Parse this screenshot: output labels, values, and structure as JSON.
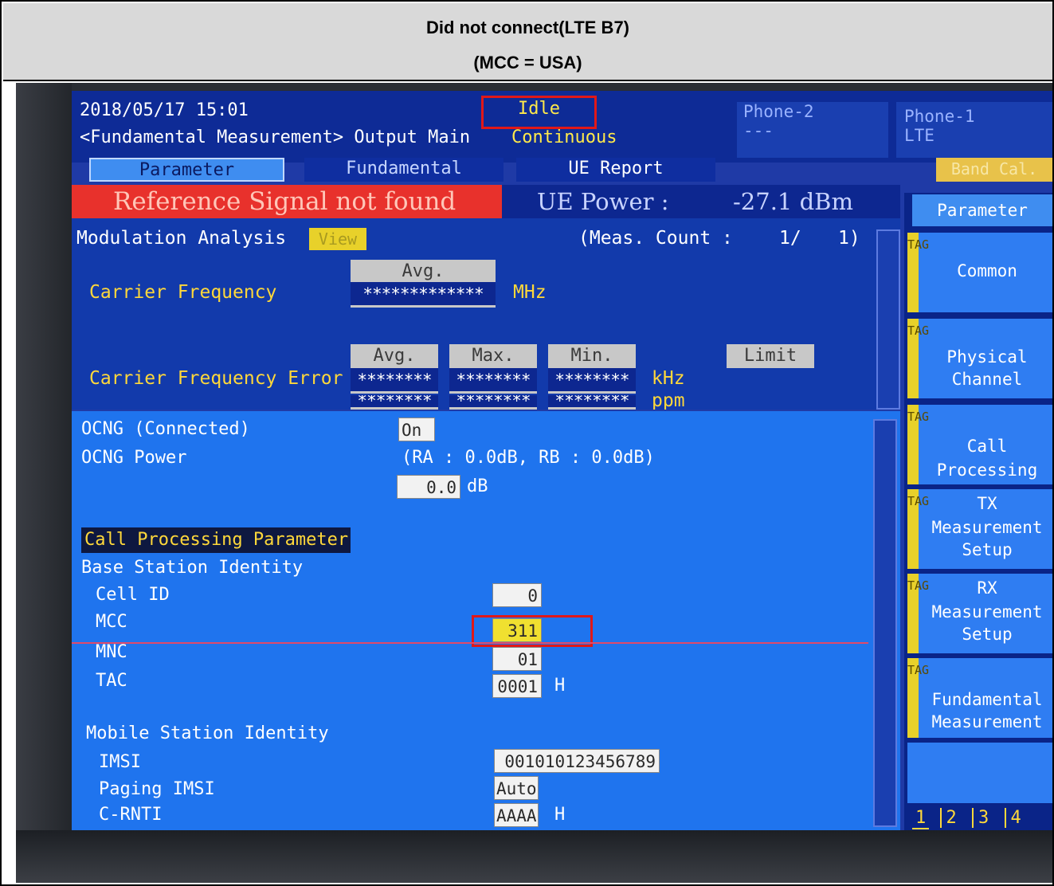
{
  "caption": {
    "line1": "Did not connect(LTE B7)",
    "line2": "(MCC = USA)"
  },
  "header": {
    "datetime": "2018/05/17 15:01",
    "mode": "<Fundamental Measurement> Output Main",
    "status": "Idle",
    "continuous": "Continuous",
    "phone2": {
      "title": "Phone-2",
      "value": "---"
    },
    "phone1": {
      "title": "Phone-1",
      "value": "LTE"
    }
  },
  "tabs": {
    "parameter": "Parameter",
    "fundamental": "Fundamental",
    "ue_report": "UE Report",
    "band_cal": "Band Cal."
  },
  "status_bar": {
    "alert": "Reference Signal not found",
    "ue_power_label": "UE Power :",
    "ue_power_value": "-27.1 dBm"
  },
  "modulation": {
    "title": "Modulation Analysis",
    "view_button": "View",
    "meas_count": "(Meas. Count :",
    "meas_value": "1/",
    "meas_total": "1)",
    "avg_header": "Avg.",
    "carrier_freq_label": "Carrier Frequency",
    "carrier_freq_value": "*************",
    "carrier_freq_unit": "MHz",
    "headers": {
      "avg": "Avg.",
      "max": "Max.",
      "min": "Min.",
      "limit": "Limit"
    },
    "cfe_label": "Carrier Frequency Error",
    "cfe_avg": "********",
    "cfe_max": "********",
    "cfe_min": "********",
    "cfe_unit": "kHz",
    "row2_avg": "********",
    "row2_max": "********",
    "row2_min": "********",
    "row2_unit": "ppm"
  },
  "params": {
    "ocng_label": "OCNG (Connected)",
    "ocng_value": "On",
    "ocng_power_label": "OCNG Power",
    "ocng_power_detail": "(RA :     0.0dB, RB :      0.0dB)",
    "ocng_power_value": "0.0",
    "ocng_power_unit": "dB",
    "section_title": "Call Processing Parameter",
    "base_station_identity": "Base Station Identity",
    "cell_id_label": "Cell ID",
    "cell_id_value": "0",
    "mcc_label": "MCC",
    "mcc_value": "311",
    "mnc_label": "MNC",
    "mnc_value": "01",
    "tac_label": "TAC",
    "tac_value": "0001",
    "tac_unit": "H",
    "mobile_station_identity": "Mobile Station Identity",
    "imsi_label": "IMSI",
    "imsi_value": "001010123456789",
    "paging_imsi_label": "Paging IMSI",
    "paging_imsi_value": "Auto",
    "crnti_label": "C-RNTI",
    "crnti_value": "AAAA",
    "crnti_unit": "H"
  },
  "menu": {
    "title": "Parameter",
    "tag_letters": "TAG",
    "common": "Common",
    "physical_channel_1": "Physical",
    "physical_channel_2": "Channel",
    "call_processing_1": "Call",
    "call_processing_2": "Processing",
    "tx_setup_1": "TX",
    "tx_setup_2": "Measurement",
    "tx_setup_3": "Setup",
    "rx_setup_1": "RX",
    "rx_setup_2": "Measurement",
    "rx_setup_3": "Setup",
    "fund_meas_1": "Fundamental",
    "fund_meas_2": "Measurement",
    "pages": [
      "1",
      "2",
      "3",
      "4"
    ]
  },
  "colors": {
    "accent_yellow": "#ffd83a",
    "alert_red": "#e8312c",
    "highlight_box": "#e01818",
    "screen_blue": "#1f74ee"
  }
}
